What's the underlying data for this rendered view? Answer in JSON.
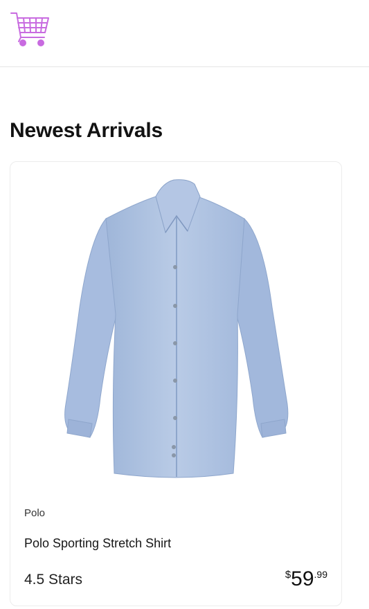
{
  "header": {
    "logo_icon": "shopping-cart-icon",
    "logo_color": "#c86be0"
  },
  "main": {
    "section_title": "Newest Arrivals",
    "products": [
      {
        "brand": "Polo",
        "name": "Polo Sporting Stretch Shirt",
        "rating": "4.5 Stars",
        "price_currency": "$",
        "price_whole": "59",
        "price_cents": ".99",
        "image_icon": "blue-dress-shirt-image"
      }
    ]
  }
}
